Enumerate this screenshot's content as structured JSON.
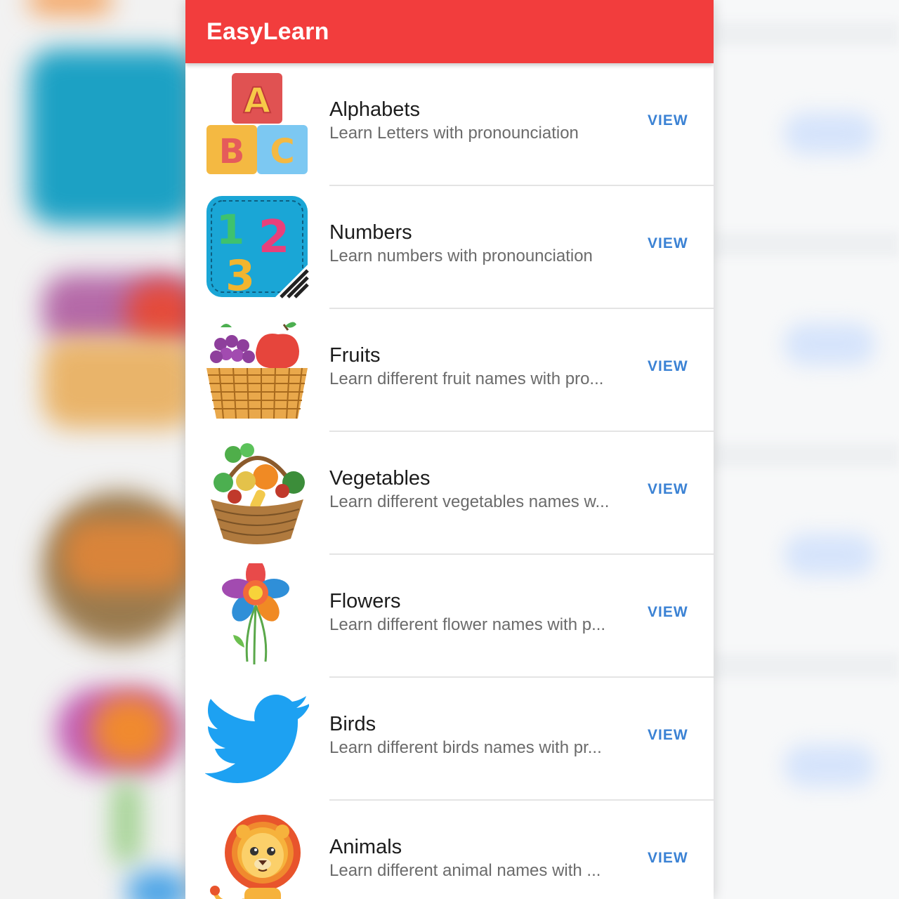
{
  "app": {
    "title": "EasyLearn"
  },
  "colors": {
    "appbar": "#f23d3d",
    "action": "#3b82d4"
  },
  "list": {
    "items": [
      {
        "icon": "abc-blocks-icon",
        "title": "Alphabets",
        "subtitle": "Learn Letters with pronounciation",
        "action": "VIEW"
      },
      {
        "icon": "numbers-123-icon",
        "title": "Numbers",
        "subtitle": "Learn numbers with pronounciation",
        "action": "VIEW"
      },
      {
        "icon": "fruit-basket-icon",
        "title": "Fruits",
        "subtitle": "Learn different fruit names with pro...",
        "action": "VIEW"
      },
      {
        "icon": "vegetable-basket-icon",
        "title": "Vegetables",
        "subtitle": "Learn different vegetables names w...",
        "action": "VIEW"
      },
      {
        "icon": "flower-bouquet-icon",
        "title": "Flowers",
        "subtitle": "Learn different flower names with p...",
        "action": "VIEW"
      },
      {
        "icon": "bird-icon",
        "title": "Birds",
        "subtitle": "Learn different birds names with pr...",
        "action": "VIEW"
      },
      {
        "icon": "lion-icon",
        "title": "Animals",
        "subtitle": "Learn different animal names with ...",
        "action": "VIEW"
      }
    ]
  }
}
